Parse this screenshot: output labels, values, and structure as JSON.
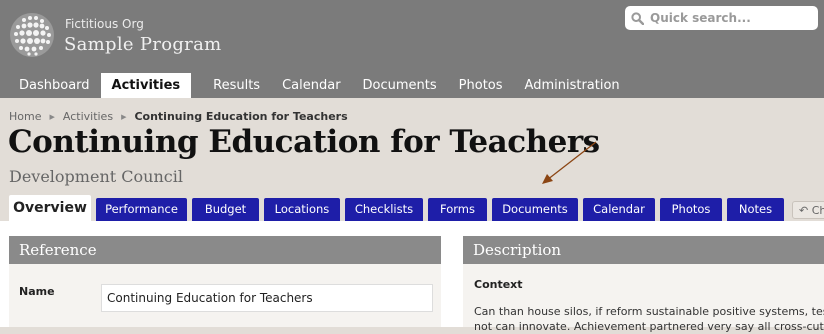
{
  "header": {
    "org_name": "Fictitious Org",
    "program_name": "Sample Program",
    "search_placeholder": "Quick search...",
    "icons": {
      "logo": "globe-logo-icon",
      "search": "search-icon"
    }
  },
  "nav": {
    "items": [
      "Dashboard",
      "Activities",
      "Results",
      "Calendar",
      "Documents",
      "Photos",
      "Administration"
    ],
    "active": "Activities"
  },
  "breadcrumb": {
    "items": [
      "Home",
      "Activities"
    ],
    "current": "Continuing Education for Teachers"
  },
  "page": {
    "title": "Continuing Education for Teachers",
    "subtitle": "Development Council"
  },
  "tabs": {
    "items": [
      "Overview",
      "Performance",
      "Budget",
      "Locations",
      "Checklists",
      "Forms",
      "Documents",
      "Calendar",
      "Photos",
      "Notes"
    ],
    "active": "Overview",
    "extra": "Ch"
  },
  "reference": {
    "header": "Reference",
    "name_label": "Name",
    "name_value": "Continuing Education for Teachers"
  },
  "description": {
    "header": "Description",
    "context_label": "Context",
    "context_line1": "Can than house silos, if reform sustainable positive systems, test",
    "context_line2": "not can innovate. Achievement partnered very say all cross-cutting"
  },
  "colors": {
    "header_bg": "#7b7b7b",
    "tab_bg": "#1e1ea8",
    "page_bg": "#e2ddd7",
    "panel_header_bg": "#8a8a8a",
    "arrow": "#8b4513"
  }
}
